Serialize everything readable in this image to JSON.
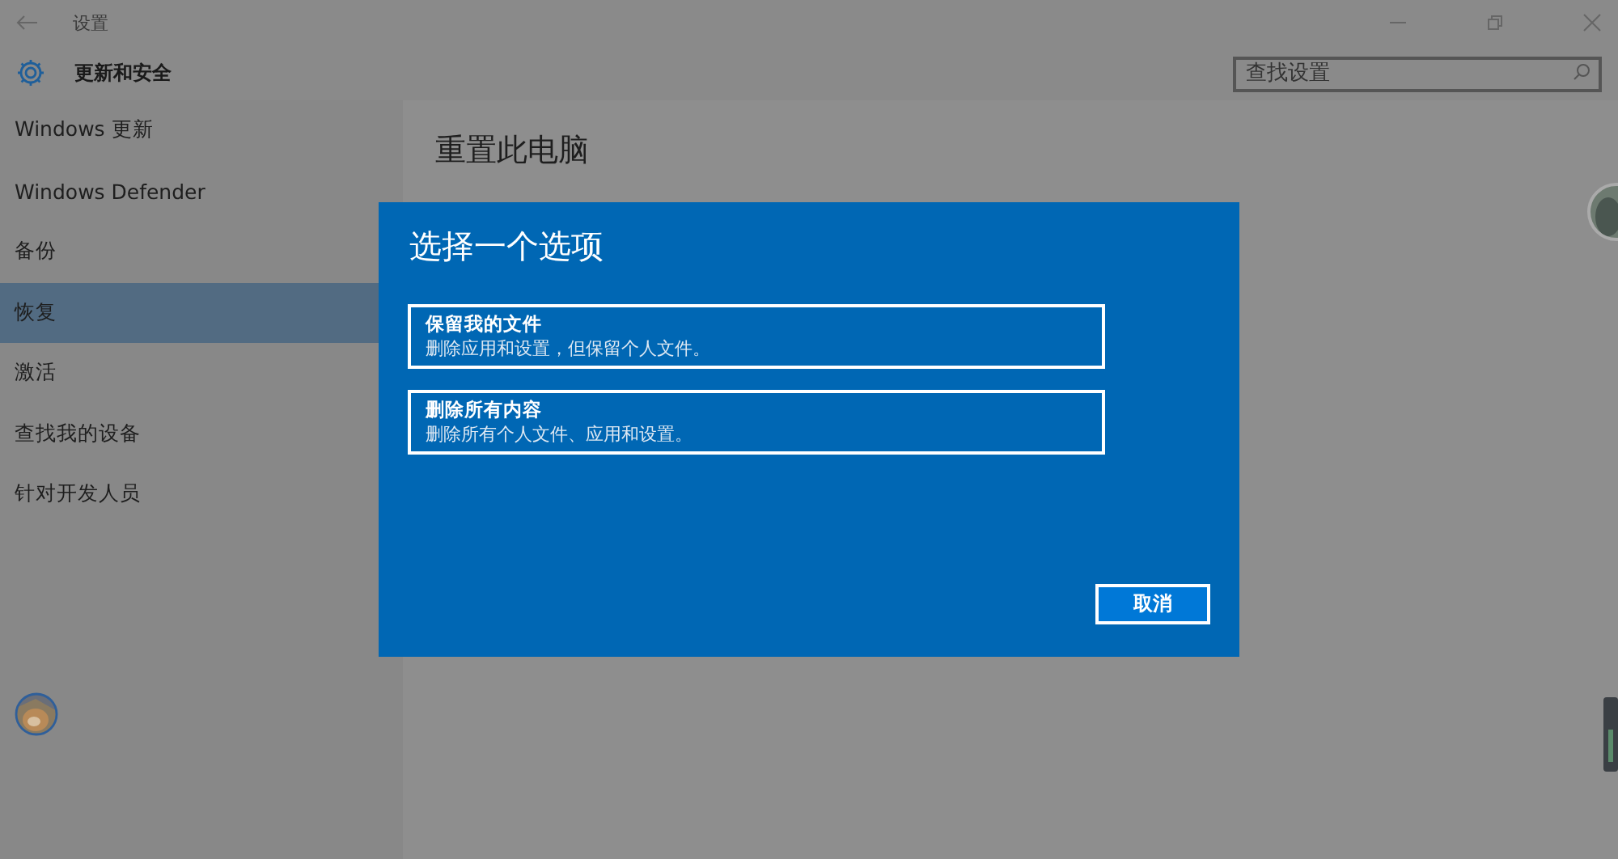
{
  "window": {
    "title": "设置"
  },
  "header": {
    "title": "更新和安全",
    "search": {
      "placeholder": "查找设置"
    }
  },
  "sidebar": {
    "items": [
      {
        "label": "Windows 更新",
        "selected": false
      },
      {
        "label": "Windows Defender",
        "selected": false
      },
      {
        "label": "备份",
        "selected": false
      },
      {
        "label": "恢复",
        "selected": true
      },
      {
        "label": "激活",
        "selected": false
      },
      {
        "label": "查找我的设备",
        "selected": false
      },
      {
        "label": "针对开发人员",
        "selected": false
      }
    ]
  },
  "content": {
    "title": "重置此电脑"
  },
  "dialog": {
    "title": "选择一个选项",
    "options": [
      {
        "title": "保留我的文件",
        "description": "删除应用和设置，但保留个人文件。"
      },
      {
        "title": "删除所有内容",
        "description": "删除所有个人文件、应用和设置。"
      }
    ],
    "buttons": [
      "取消"
    ]
  }
}
